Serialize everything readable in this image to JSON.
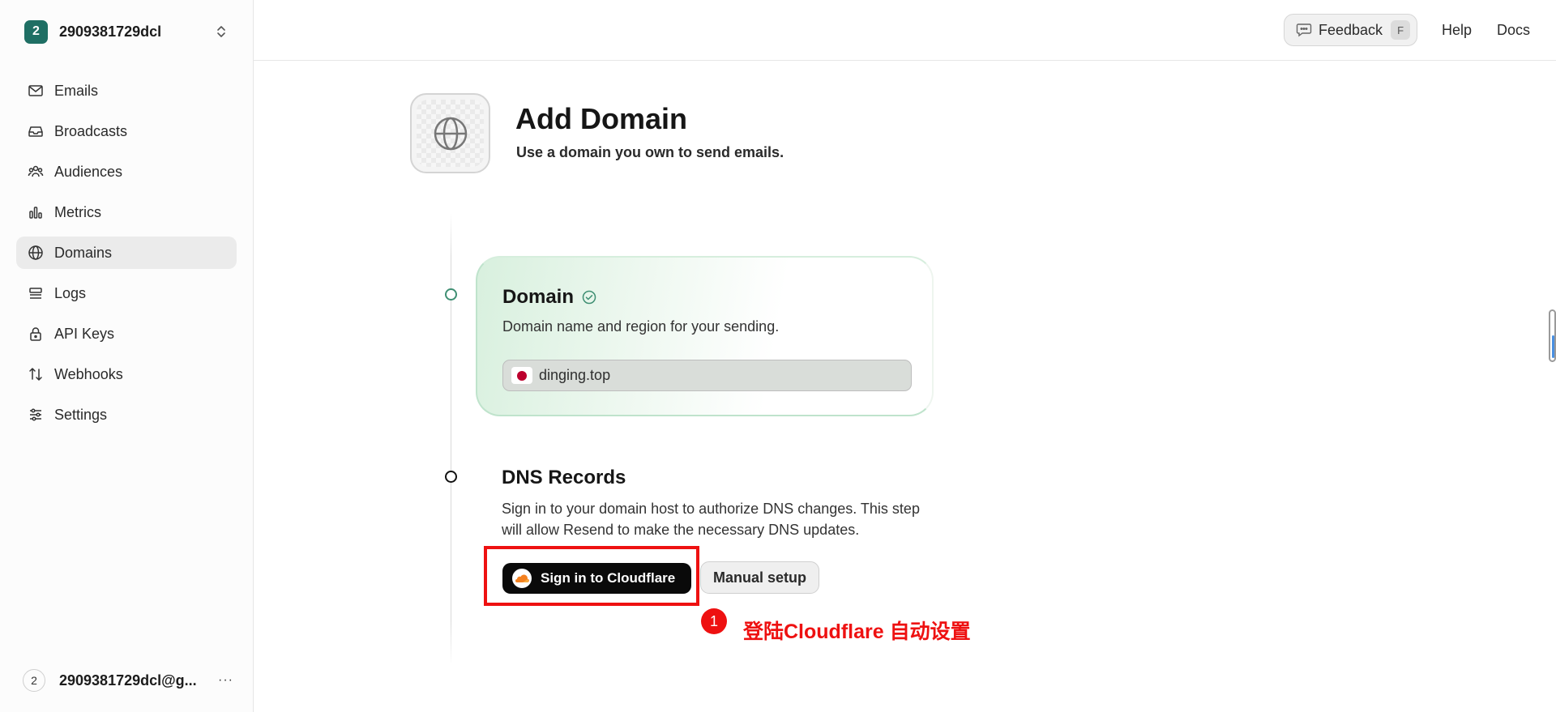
{
  "team": {
    "badge": "2",
    "name": "2909381729dcl"
  },
  "sidebar": {
    "items": [
      {
        "label": "Emails",
        "icon": "mail-icon",
        "active": false
      },
      {
        "label": "Broadcasts",
        "icon": "inbox-icon",
        "active": false
      },
      {
        "label": "Audiences",
        "icon": "users-icon",
        "active": false
      },
      {
        "label": "Metrics",
        "icon": "bar-chart-icon",
        "active": false
      },
      {
        "label": "Domains",
        "icon": "globe-icon",
        "active": true
      },
      {
        "label": "Logs",
        "icon": "logs-icon",
        "active": false
      },
      {
        "label": "API Keys",
        "icon": "lock-icon",
        "active": false
      },
      {
        "label": "Webhooks",
        "icon": "arrows-icon",
        "active": false
      },
      {
        "label": "Settings",
        "icon": "sliders-icon",
        "active": false
      }
    ]
  },
  "user": {
    "avatar": "2",
    "email": "2909381729dcl@g...",
    "more": "···"
  },
  "topbar": {
    "feedback_label": "Feedback",
    "feedback_shortcut": "F",
    "help_label": "Help",
    "docs_label": "Docs"
  },
  "page": {
    "title": "Add Domain",
    "subtitle": "Use a domain you own to send emails."
  },
  "domain_step": {
    "title": "Domain",
    "description": "Domain name and region for your sending.",
    "value": "dinging.top",
    "region_flag": "japan-flag-icon"
  },
  "dns_step": {
    "title": "DNS Records",
    "description": "Sign in to your domain host to authorize DNS changes. This step will allow Resend to make the necessary DNS updates.",
    "cloudflare_button": "Sign in to Cloudflare",
    "manual_button": "Manual setup"
  },
  "annotation": {
    "number": "1",
    "text": "登陆Cloudflare 自动设置",
    "color": "#ee1111"
  },
  "colors": {
    "accent_green": "#3f8f73",
    "team_badge": "#1f6f64",
    "active_nav_bg": "#ebebeb"
  }
}
